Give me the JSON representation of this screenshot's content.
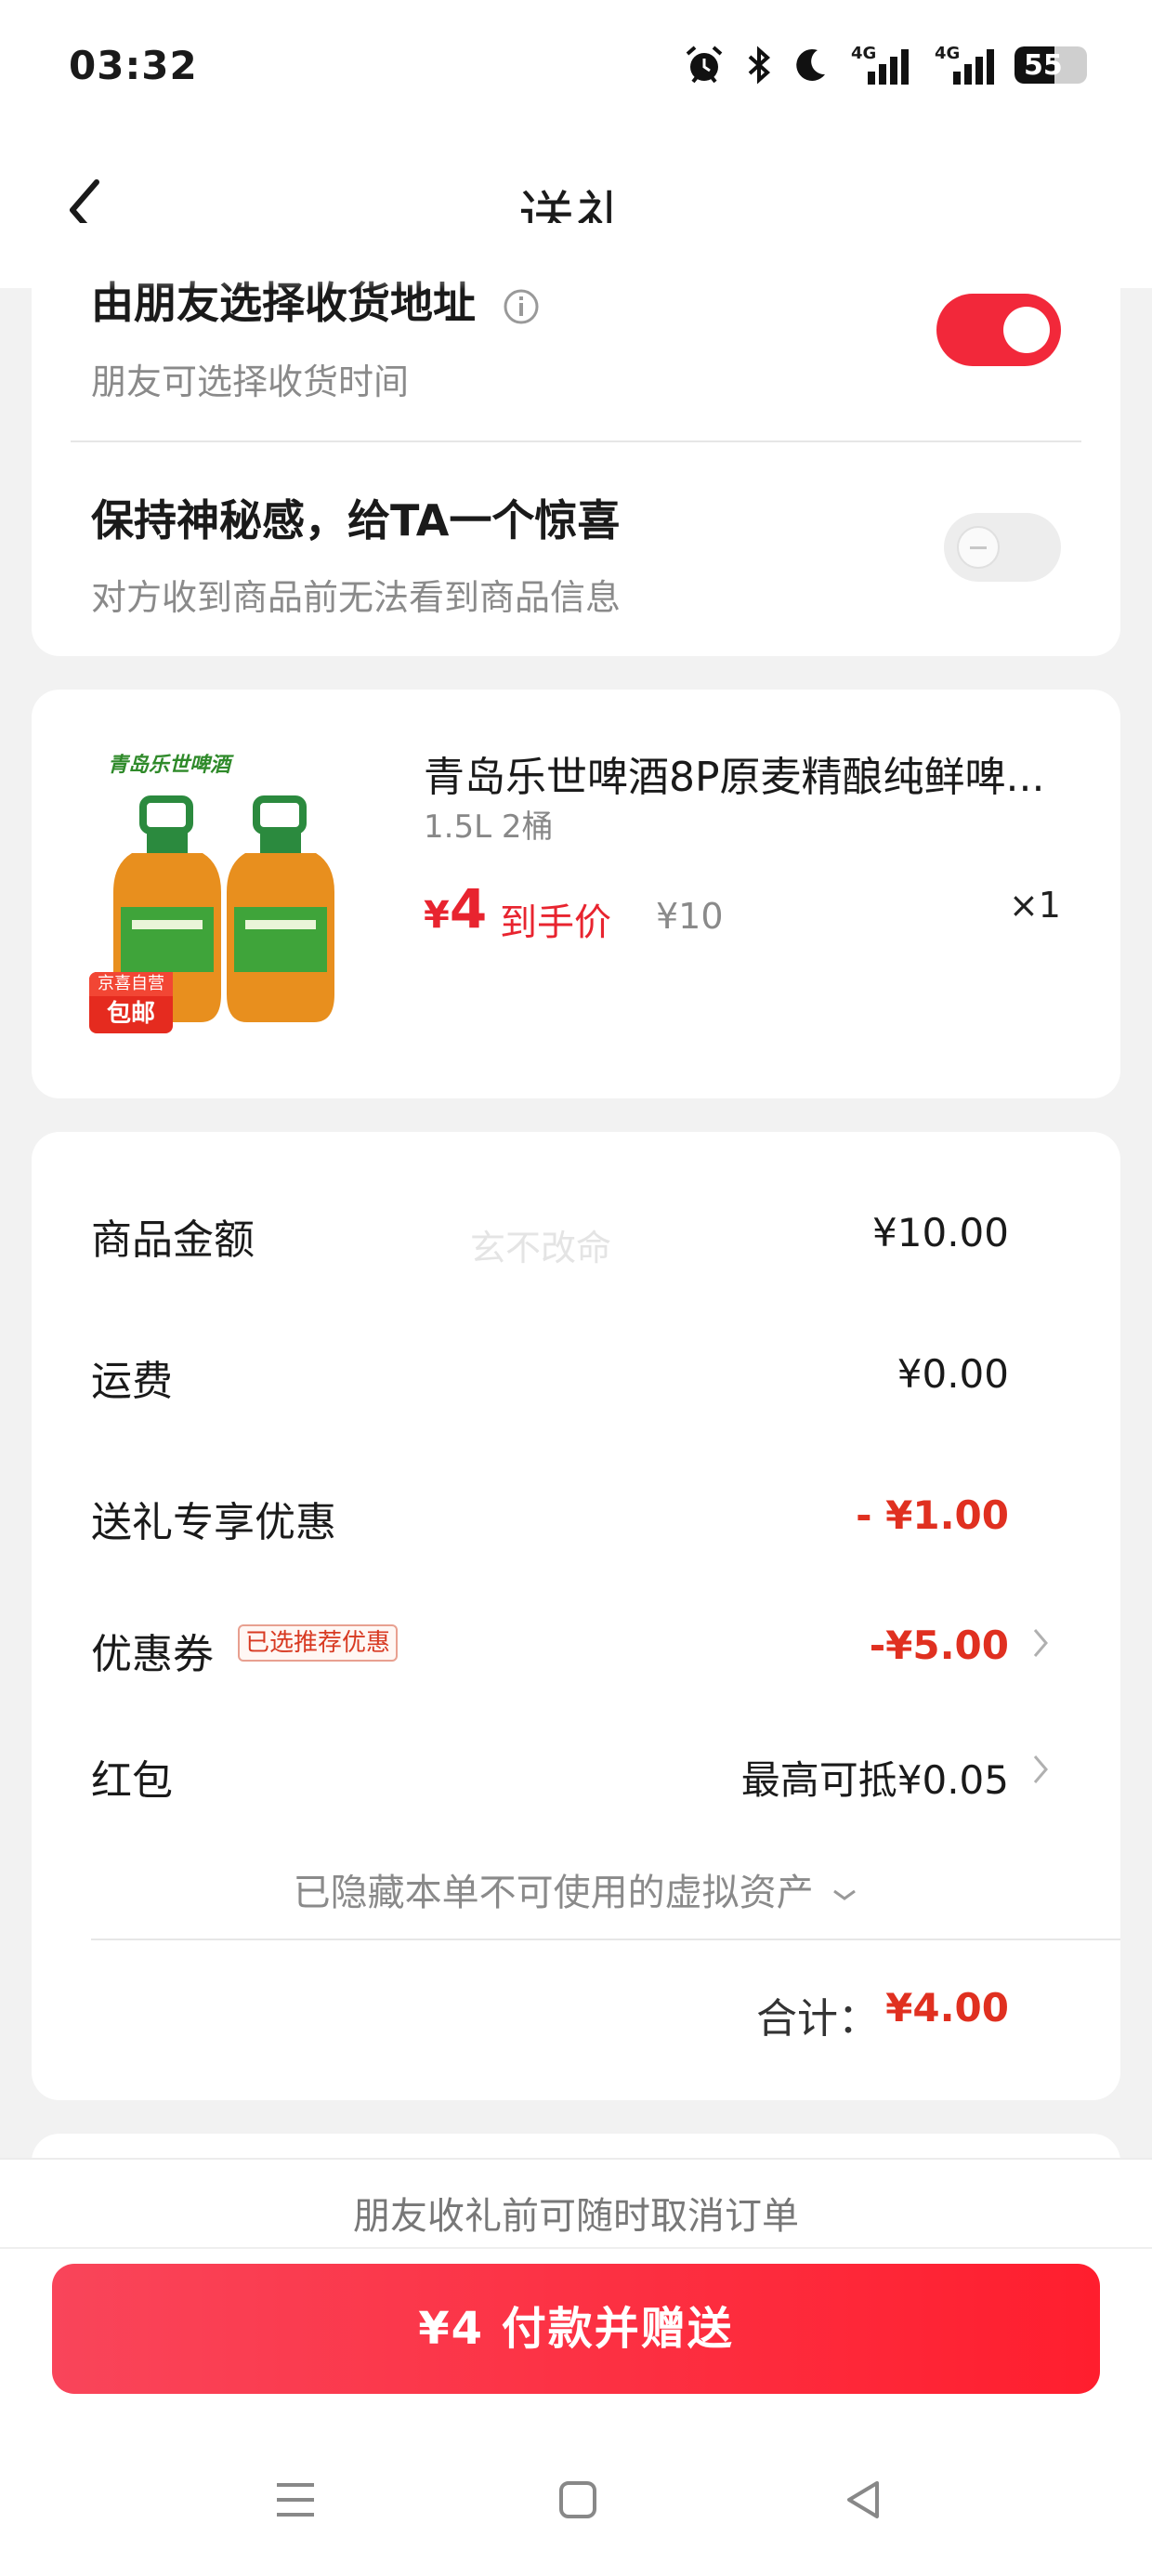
{
  "status_bar": {
    "time": "03:32",
    "icons": [
      "alarm-icon",
      "bluetooth-icon",
      "do-not-disturb-icon",
      "signal-4g-icon",
      "signal-4g-icon"
    ],
    "battery": "55",
    "battery_level": 0.55,
    "signal_label_1": "4G",
    "signal_label_2": "4G"
  },
  "header": {
    "title": "送礼"
  },
  "gift_options": {
    "friend_address": {
      "title": "由朋友选择收货地址",
      "subtitle": "朋友可选择收货时间",
      "enabled": true
    },
    "mystery": {
      "title": "保持神秘感，给TA一个惊喜",
      "subtitle": "对方收到商品前无法看到商品信息",
      "enabled": false
    }
  },
  "product": {
    "brand_label": "青岛乐世啤酒",
    "badge_top": "京喜自营",
    "badge_bottom": "包邮",
    "name": "青岛乐世啤酒8P原麦精酿纯鲜啤...",
    "spec": "1.5L 2桶",
    "price_symbol": "¥",
    "price": "4",
    "price_label": "到手价",
    "original_price": "¥10",
    "quantity": "×1"
  },
  "order_summary": {
    "watermark": "玄不改命",
    "rows": [
      {
        "label": "商品金额",
        "value": "¥10.00"
      },
      {
        "label": "运费",
        "value": "¥0.00"
      },
      {
        "label": "送礼专享优惠",
        "value": "- ¥1.00"
      },
      {
        "label": "优惠券",
        "tag": "已选推荐优惠",
        "value": "-¥5.00"
      },
      {
        "label": "红包",
        "value": "最高可抵¥0.05"
      }
    ],
    "hidden_assets": "已隐藏本单不可使用的虚拟资产",
    "total_label": "合计：",
    "total_value": "¥4.00"
  },
  "footer": {
    "cancel_note": "朋友收礼前可随时取消订单",
    "pay_button": "¥4 付款并赠送"
  },
  "colors": {
    "accent_red": "#f2283a",
    "price_red": "#e03020",
    "background": "#f2f2f2"
  }
}
